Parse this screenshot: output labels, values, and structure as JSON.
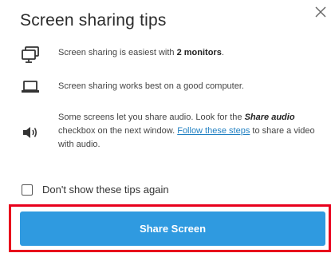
{
  "dialog": {
    "title": "Screen sharing tips",
    "close_icon": "close-icon"
  },
  "tips": [
    {
      "icon": "dual-monitor-icon",
      "text_before": "Screen sharing is easiest with ",
      "text_bold": "2 monitors",
      "text_after": "."
    },
    {
      "icon": "laptop-icon",
      "text": "Screen sharing works best on a good computer."
    },
    {
      "icon": "speaker-icon",
      "text_before": "Some screens let you share audio. Look for the ",
      "text_bold_italic": "Share audio",
      "text_middle": " checkbox on the next window. ",
      "link_text": "Follow these steps",
      "text_after": " to share a video with audio."
    }
  ],
  "checkbox": {
    "label": "Don't show these tips again",
    "checked": false
  },
  "share_button": {
    "label": "Share Screen",
    "color": "#2f9ae0"
  },
  "highlight": {
    "color": "#e8001c"
  }
}
